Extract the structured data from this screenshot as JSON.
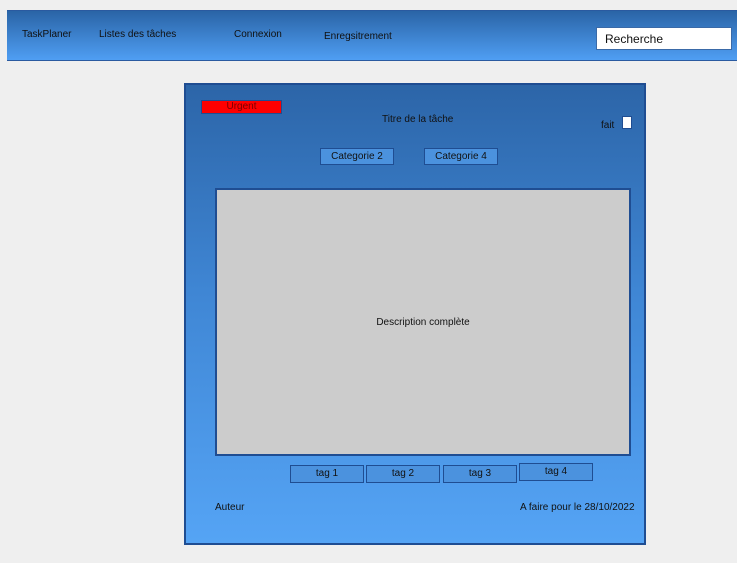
{
  "navbar": {
    "brand": "TaskPlaner",
    "items": [
      {
        "label": "Listes des tâches"
      },
      {
        "label": "Connexion"
      },
      {
        "label": "Enregsitrement"
      }
    ],
    "search": {
      "placeholder": "Recherche",
      "value": ""
    }
  },
  "task": {
    "priority": "Urgent",
    "title": "Titre de la tâche",
    "done_label": "fait",
    "done": false,
    "categories": [
      "Categorie 2",
      "Categorie 4"
    ],
    "description": "Description complète",
    "tags": [
      "tag 1",
      "tag 2",
      "tag 3",
      "tag 4"
    ],
    "author": "Auteur",
    "due": "A faire pour le 28/10/2022"
  },
  "colors": {
    "navbar": "#4f9ef3",
    "card": "#3f86d4",
    "urgent": "#ff0000",
    "description_bg": "#cccccc",
    "border": "#1f4d92"
  }
}
